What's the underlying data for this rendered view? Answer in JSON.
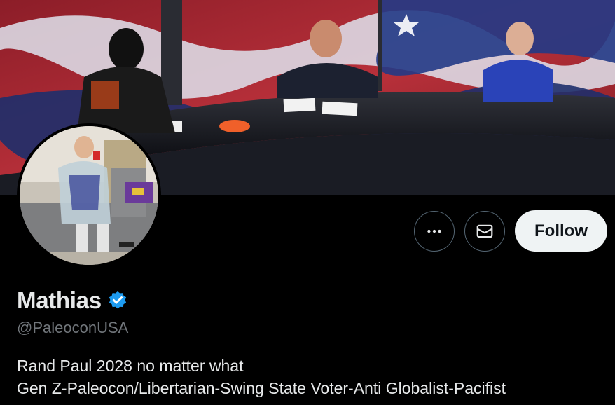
{
  "profile": {
    "display_name": "Mathias",
    "handle": "@PaleoconUSA",
    "verified_icon": "verified-badge-icon",
    "bio_lines": [
      "Rand Paul 2028 no matter what",
      "Gen Z-Paleocon/Libertarian-Swing State Voter-Anti Globalist-Pacifist"
    ]
  },
  "actions": {
    "more_icon": "more-dots-icon",
    "message_icon": "envelope-icon",
    "follow_label": "Follow"
  },
  "colors": {
    "background": "#000000",
    "text_primary": "#e7e9ea",
    "text_secondary": "#71767b",
    "verified_blue": "#1d9bf0",
    "follow_bg": "#eff3f4"
  }
}
